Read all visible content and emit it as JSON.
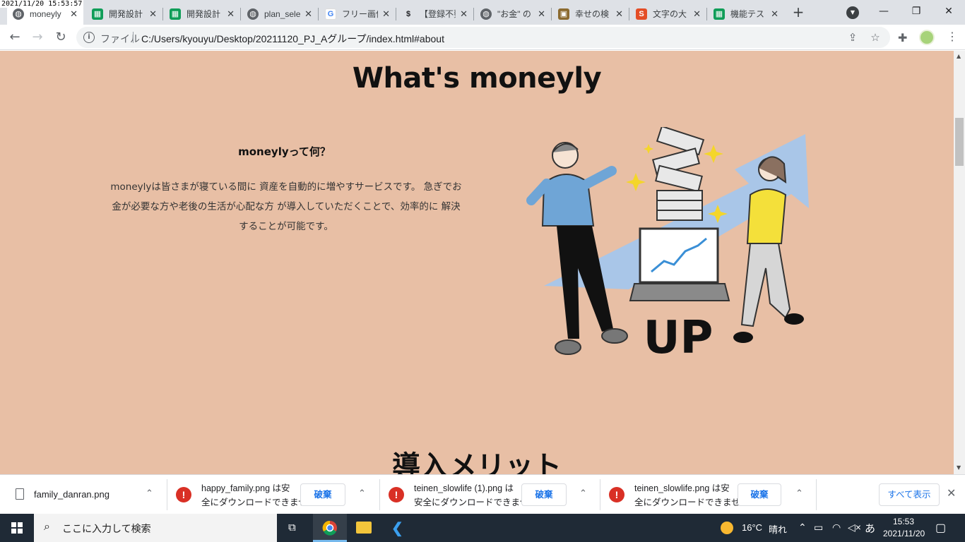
{
  "screenshot_stamp": "2021/11/20 15:53:57",
  "tabs": [
    {
      "title": "moneyly",
      "active": true,
      "favicon": "globe-icon"
    },
    {
      "title": "開発設計",
      "favicon": "sheets-icon"
    },
    {
      "title": "開発設計",
      "favicon": "sheets-icon"
    },
    {
      "title": "plan_sele",
      "favicon": "globe-icon"
    },
    {
      "title": "フリー画像",
      "favicon": "google-icon"
    },
    {
      "title": "【登録不要",
      "favicon": "dollar-icon"
    },
    {
      "title": "\"お金\" の",
      "favicon": "globe-icon"
    },
    {
      "title": "幸せの検",
      "favicon": "app-icon"
    },
    {
      "title": "文字の大",
      "favicon": "s-icon"
    },
    {
      "title": "機能テス",
      "favicon": "sheets-icon"
    }
  ],
  "address_bar": {
    "security_label": "ファイル",
    "url": "C:/Users/kyouyu/Desktop/20211120_PJ_Aグループ/index.html#about"
  },
  "page": {
    "title": "What's moneyly",
    "about_heading": "moneylyって何？",
    "about_body": "moneylyは皆さまが寝ている間に 資産を自動的に増やすサービスです。 急ぎでお金が必要な方や老後の生活が心配な方 が導入していただくことで、効率的に 解決することが可能です。",
    "illustration_text": "UP",
    "next_section_title": "導入メリット"
  },
  "downloads": [
    {
      "filename": "family_danran.png"
    },
    {
      "line1": "happy_family.png は安",
      "line2": "全にダウンロードできません",
      "action": "破棄"
    },
    {
      "line1": "teinen_slowlife (1).png は",
      "line2": "安全にダウンロードできません",
      "action": "破棄"
    },
    {
      "line1": "teinen_slowlife.png は安",
      "line2": "全にダウンロードできません",
      "action": "破棄"
    }
  ],
  "downloads_show_all": "すべて表示",
  "taskbar": {
    "search_placeholder": "ここに入力して検索",
    "weather_temp": "16°C",
    "weather_desc": "晴れ",
    "ime": "あ",
    "time": "15:53",
    "date": "2021/11/20"
  }
}
